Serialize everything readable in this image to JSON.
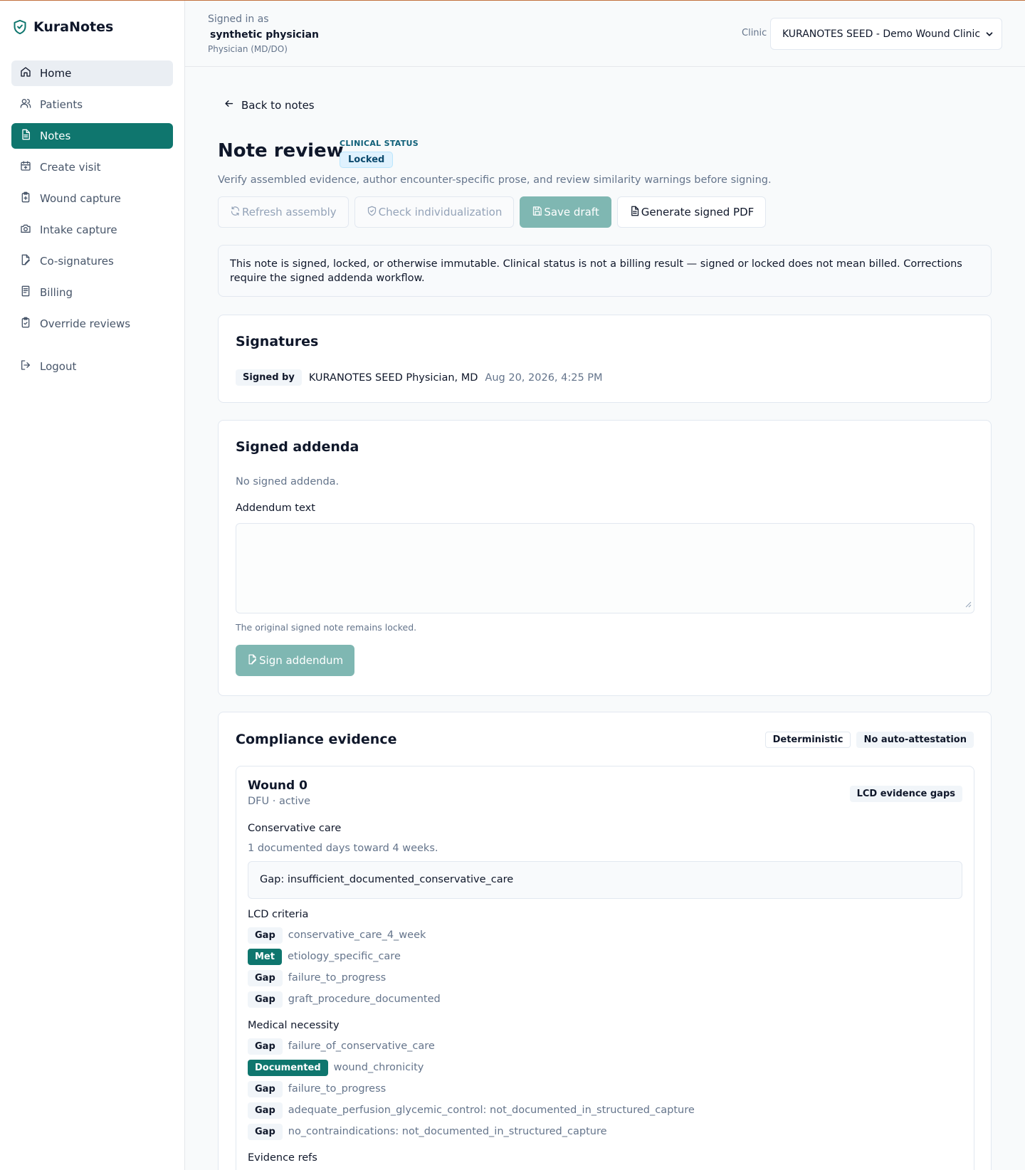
{
  "brand": {
    "name": "KuraNotes"
  },
  "sidebar": {
    "items": [
      {
        "label": "Home"
      },
      {
        "label": "Patients"
      },
      {
        "label": "Notes"
      },
      {
        "label": "Create visit"
      },
      {
        "label": "Wound capture"
      },
      {
        "label": "Intake capture"
      },
      {
        "label": "Co-signatures"
      },
      {
        "label": "Billing"
      },
      {
        "label": "Override reviews"
      }
    ],
    "logout": "Logout"
  },
  "header": {
    "signed_in_label": "Signed in as",
    "user_name": "synthetic physician",
    "user_role": "Physician (MD/DO)",
    "clinic_label": "Clinic",
    "clinic_value": "KURANOTES SEED - Demo Wound Clinic"
  },
  "page": {
    "back_link": "Back to notes",
    "title": "Note review",
    "status_caption": "CLINICAL STATUS",
    "status": "Locked",
    "subtitle": "Verify assembled evidence, author encounter-specific prose, and review similarity warnings before signing.",
    "buttons": {
      "refresh": "Refresh assembly",
      "check": "Check individualization",
      "save": "Save draft",
      "pdf": "Generate signed PDF"
    },
    "notice": "This note is signed, locked, or otherwise immutable. Clinical status is not a billing result — signed or locked does not mean billed. Corrections require the signed addenda workflow."
  },
  "signatures": {
    "heading": "Signatures",
    "label": "Signed by",
    "signer": "KURANOTES SEED Physician, MD",
    "timestamp": "Aug 20, 2026, 4:25 PM"
  },
  "addenda": {
    "heading": "Signed addenda",
    "empty": "No signed addenda.",
    "field_label": "Addendum text",
    "help": "The original signed note remains locked.",
    "sign_button": "Sign addendum"
  },
  "compliance": {
    "heading": "Compliance evidence",
    "badges": [
      "Deterministic",
      "No auto-attestation"
    ],
    "wound": {
      "title": "Wound 0",
      "subtitle": "DFU · active",
      "badge": "LCD evidence gaps",
      "conservative_label": "Conservative care",
      "conservative_text": "1 documented days toward 4 weeks.",
      "gap_text": "Gap: insufficient_documented_conservative_care",
      "lcd_label": "LCD criteria",
      "lcd": [
        {
          "status": "Gap",
          "text": "conservative_care_4_week"
        },
        {
          "status": "Met",
          "text": "etiology_specific_care"
        },
        {
          "status": "Gap",
          "text": "failure_to_progress"
        },
        {
          "status": "Gap",
          "text": "graft_procedure_documented"
        }
      ],
      "necessity_label": "Medical necessity",
      "necessity": [
        {
          "status": "Gap",
          "text": "failure_of_conservative_care"
        },
        {
          "status": "Documented",
          "text": "wound_chronicity"
        },
        {
          "status": "Gap",
          "text": "failure_to_progress"
        },
        {
          "status": "Gap",
          "text": "adequate_perfusion_glycemic_control: not_documented_in_structured_capture"
        },
        {
          "status": "Gap",
          "text": "no_contraindications: not_documented_in_structured_capture"
        }
      ],
      "evidence_label": "Evidence refs"
    }
  },
  "colors": {
    "accent": "#0f766e",
    "accent_disabled": "#7fb7b2",
    "status_blue": "#0c4a6e",
    "top_border": "#c2703d"
  }
}
